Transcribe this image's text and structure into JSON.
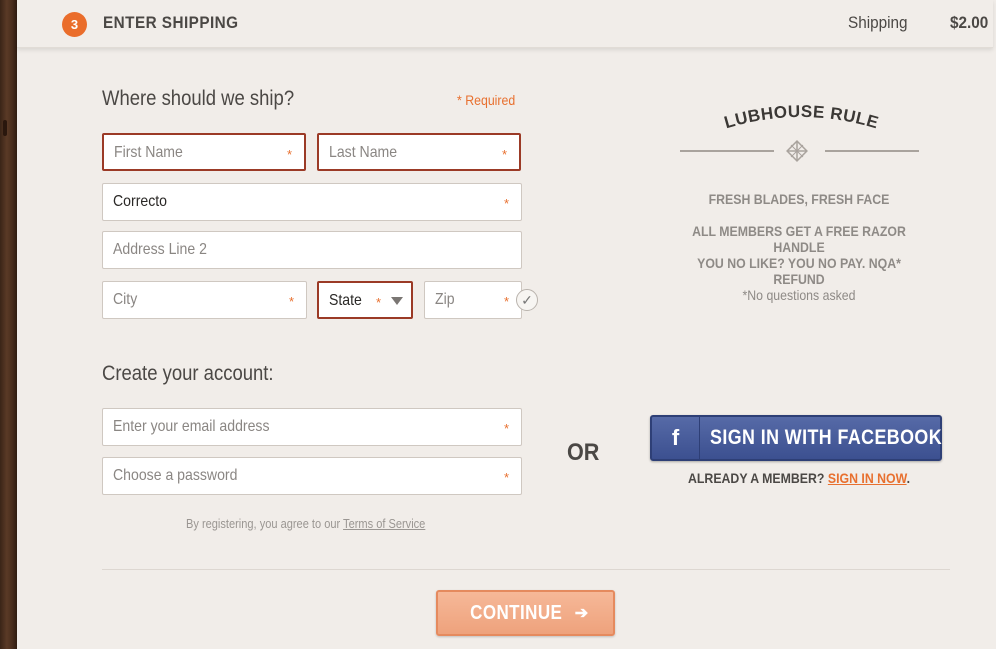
{
  "header": {
    "step_number": "3",
    "step_title": "ENTER SHIPPING",
    "shipping_label": "Shipping",
    "shipping_price": "$2.00"
  },
  "shipping_form": {
    "title": "Where should we ship?",
    "required_note": "* Required",
    "first_name": {
      "placeholder": "First Name",
      "required": "*"
    },
    "last_name": {
      "placeholder": "Last Name",
      "required": "*"
    },
    "address1": {
      "value": "Correcto",
      "required": "*"
    },
    "address2": {
      "placeholder": "Address Line 2"
    },
    "city": {
      "placeholder": "City",
      "required": "*"
    },
    "state": {
      "value": "State",
      "required": "*"
    },
    "zip": {
      "placeholder": "Zip",
      "required": "*"
    },
    "zip_check_icon": "checkmark-icon"
  },
  "account_form": {
    "title": "Create your account:",
    "email": {
      "placeholder": "Enter your email address",
      "required": "*"
    },
    "password": {
      "placeholder": "Choose a password",
      "required": "*"
    },
    "terms_prefix": "By registering, you agree to our ",
    "terms_link": "Terms of Service"
  },
  "or_label": "OR",
  "clubhouse": {
    "title": "CLUBHOUSE RULES",
    "rules": [
      "FRESH BLADES, FRESH FACE",
      "ALL MEMBERS GET A FREE RAZOR HANDLE",
      "YOU NO LIKE? YOU NO PAY. NQA* REFUND"
    ],
    "footnote": "*No questions asked"
  },
  "facebook": {
    "icon": "f",
    "label": "SIGN IN WITH FACEBOOK"
  },
  "member": {
    "prefix": "ALREADY A MEMBER? ",
    "link": "SIGN IN NOW",
    "suffix": "."
  },
  "continue": {
    "label": "CONTINUE",
    "arrow": "➔"
  },
  "colors": {
    "accent": "#e8702f",
    "error_border": "#9b3a26",
    "facebook": "#3c5090",
    "background": "#f1ede9"
  }
}
